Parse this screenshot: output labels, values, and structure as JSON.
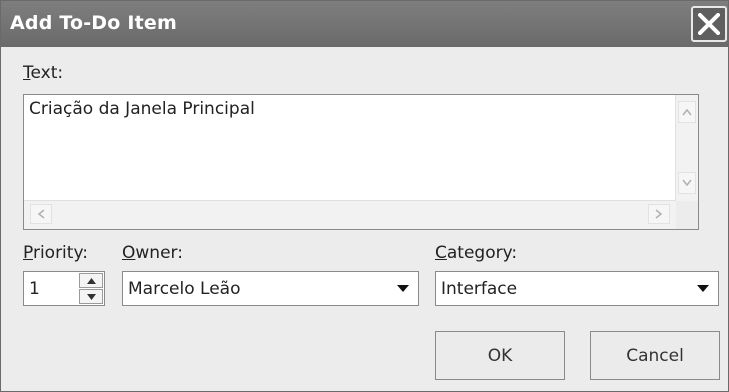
{
  "window": {
    "title": "Add To-Do Item"
  },
  "text_field": {
    "label_mnemonic": "T",
    "label_rest": "ext:",
    "value": "Criação da Janela Principal"
  },
  "priority": {
    "label_mnemonic": "P",
    "label_rest": "riority:",
    "value": "1"
  },
  "owner": {
    "label_mnemonic": "O",
    "label_rest": "wner:",
    "value": "Marcelo Leão"
  },
  "category": {
    "label_mnemonic": "C",
    "label_rest": "ategory:",
    "value": "Interface"
  },
  "buttons": {
    "ok": "OK",
    "cancel": "Cancel"
  },
  "icons": {
    "close": "close-icon",
    "scroll_up": "chevron-up-icon",
    "scroll_down": "chevron-down-icon",
    "scroll_left": "chevron-left-icon",
    "scroll_right": "chevron-right-icon",
    "dropdown": "triangle-down-icon"
  },
  "colors": {
    "titlebar": "#6f6f6f",
    "dialog_bg": "#ececec"
  }
}
